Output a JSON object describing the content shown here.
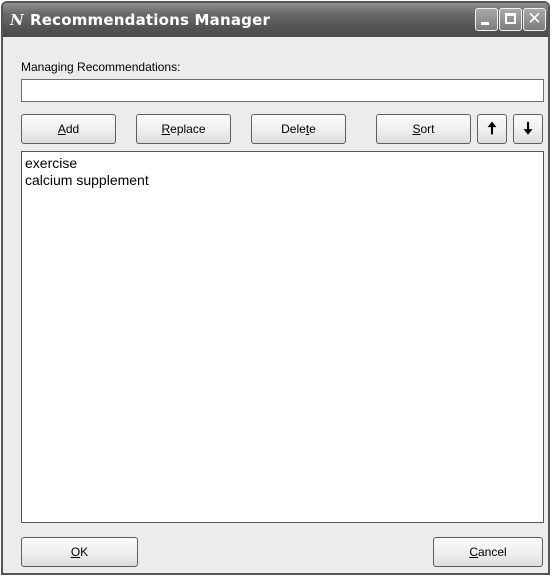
{
  "window": {
    "title": "Recommendations Manager",
    "app_icon": "N"
  },
  "titlebar_buttons": {
    "close_glyph": "✕"
  },
  "form": {
    "managing_label": "Managing Recommendations:",
    "input_value": "",
    "input_placeholder": ""
  },
  "toolbar": {
    "add": {
      "mnemonic": "A",
      "rest": "dd"
    },
    "replace": {
      "mnemonic": "R",
      "rest": "eplace"
    },
    "delete": {
      "pre": "Dele",
      "mnemonic": "t",
      "post": "e"
    },
    "sort": {
      "mnemonic": "S",
      "rest": "ort"
    },
    "move_up_glyph": "🠅",
    "move_down_glyph": "🠇"
  },
  "list": {
    "items": [
      "exercise",
      "calcium supplement"
    ]
  },
  "footer": {
    "ok": {
      "mnemonic": "O",
      "rest": "K"
    },
    "cancel": {
      "mnemonic": "C",
      "rest": "ancel"
    }
  },
  "colors": {
    "titlebar": "#555555",
    "dialog_background": "#ececec",
    "border": "#555555"
  },
  "icons": {
    "app": "app-logo-icon",
    "minimize": "minimize-icon",
    "maximize": "maximize-icon",
    "close": "close-icon",
    "up": "arrow-up-icon",
    "down": "arrow-down-icon"
  }
}
